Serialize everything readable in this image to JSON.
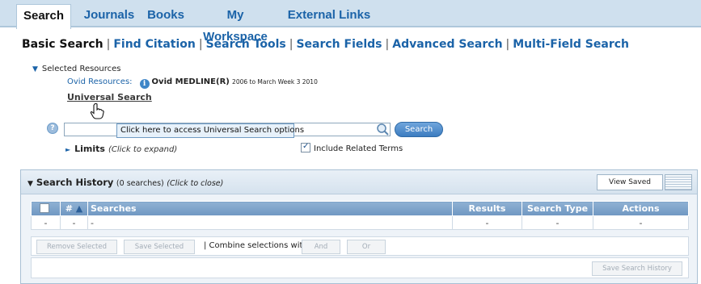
{
  "tabs": [
    {
      "label": "Search"
    },
    {
      "label": "Journals"
    },
    {
      "label": "Books"
    },
    {
      "label": "My Workspace"
    },
    {
      "label": "External Links"
    }
  ],
  "subnav": {
    "basic": "Basic Search",
    "citation": "Find Citation",
    "tools": "Search Tools",
    "fields": "Search Fields",
    "advanced": "Advanced Search",
    "multi": "Multi-Field Search",
    "separator": "|"
  },
  "resources": {
    "toggle_label": "Selected Resources",
    "ovid_label": "Ovid Resources:",
    "db_name": "Ovid MEDLINE(R)",
    "db_range": "2006 to March Week 3 2010",
    "universal_link": "Universal Search"
  },
  "search": {
    "input_value": "",
    "tooltip": "Click here to access Universal Search options",
    "button_label": "Search",
    "limits_label": "Limits",
    "limits_hint": "(Click to expand)",
    "related_label": "Include Related Terms",
    "related_checked": true
  },
  "history": {
    "title": "Search History",
    "count_text": "(0 searches)",
    "close_hint": "(Click to close)",
    "view_saved": "View Saved",
    "columns": {
      "num": "#",
      "sort_arrow": "▲",
      "searches": "Searches",
      "results": "Results",
      "type": "Search Type",
      "actions": "Actions"
    },
    "row": {
      "num": "-",
      "sel": "-",
      "searches": "-",
      "results": "-",
      "type": "-",
      "actions": "-"
    },
    "remove_selected": "Remove Selected",
    "save_selected": "Save Selected",
    "combine_label": "| Combine selections with:",
    "and_label": "And",
    "or_label": "Or",
    "save_history": "Save Search History"
  },
  "colors": {
    "accent": "#1b63a8",
    "tab_bar": "#cfe0ee",
    "table_header": "#7ea4cb"
  }
}
